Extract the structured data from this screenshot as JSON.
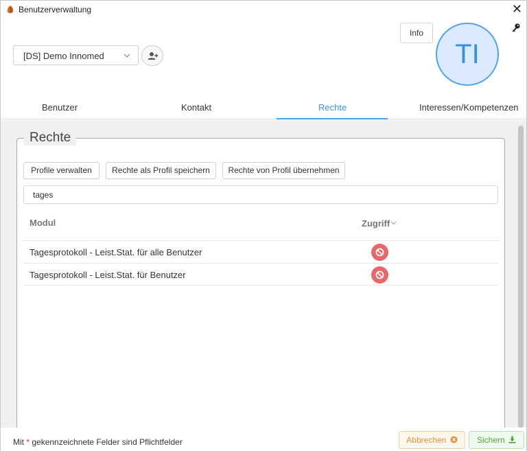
{
  "window": {
    "title": "Benutzerverwaltung",
    "close_symbol": "✕"
  },
  "header": {
    "mandant_value": "[DS] Demo Innomed",
    "info_label": "Info",
    "avatar_initials": "TI"
  },
  "tabs": [
    {
      "label": "Benutzer"
    },
    {
      "label": "Kontakt"
    },
    {
      "label": "Rechte",
      "active": true
    },
    {
      "label": "Interessen/Kompetenzen"
    }
  ],
  "rights": {
    "legend": "Rechte",
    "buttons": {
      "manage_profiles": "Profile verwalten",
      "save_as_profile": "Rechte als Profil speichern",
      "apply_from_profile": "Rechte von Profil übernehmen"
    },
    "filter_value": "tages",
    "columns": {
      "module": "Modul",
      "access": "Zugriff"
    },
    "rows": [
      {
        "module": "Tagesprotokoll - Leist.Stat. für alle Benutzer",
        "access": "denied"
      },
      {
        "module": "Tagesprotokoll - Leist.Stat. für Benutzer",
        "access": "denied"
      }
    ]
  },
  "footer": {
    "note_prefix": "Mit ",
    "note_star": "*",
    "note_suffix": " gekennzeichnete Felder sind Pflichtfelder",
    "cancel_label": "Abbrechen",
    "save_label": "Sichern"
  },
  "colors": {
    "accent": "#3c95df",
    "denied_badge": "#e8676a",
    "cancel": "#e0913a",
    "save": "#4aa53a"
  }
}
